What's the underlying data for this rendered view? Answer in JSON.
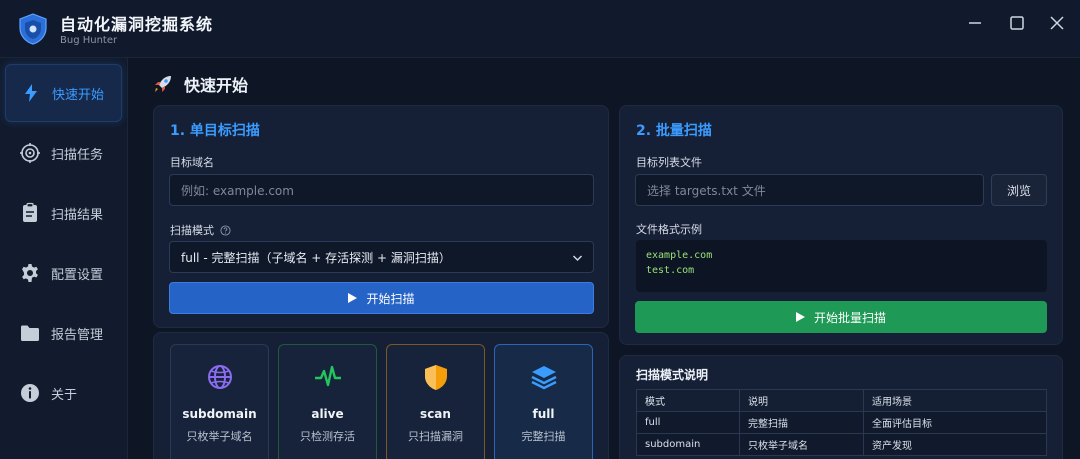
{
  "app": {
    "title": "自动化漏洞挖掘系统",
    "subtitle": "Bug Hunter",
    "logo_icon": "shield-icon",
    "accent_color": "#3b9cff"
  },
  "window_controls": {
    "minimize_icon": "minimize-icon",
    "maximize_icon": "maximize-icon",
    "close_icon": "close-icon"
  },
  "sidebar": {
    "items": [
      {
        "label": "快速开始",
        "icon": "lightning-icon",
        "active": true
      },
      {
        "label": "扫描任务",
        "icon": "target-icon",
        "active": false
      },
      {
        "label": "扫描结果",
        "icon": "clipboard-icon",
        "active": false
      },
      {
        "label": "配置设置",
        "icon": "gear-icon",
        "active": false
      },
      {
        "label": "报告管理",
        "icon": "folder-icon",
        "active": false
      },
      {
        "label": "关于",
        "icon": "info-icon",
        "active": false
      }
    ]
  },
  "main": {
    "page_title": "快速开始",
    "page_title_icon": "rocket-icon",
    "single_scan": {
      "title": "1. 单目标扫描",
      "domain_label": "目标域名",
      "domain_placeholder": "例如: example.com",
      "mode_label": "扫描模式",
      "mode_value": "full - 完整扫描（子域名 + 存活探测 + 漏洞扫描）",
      "start_button": "开始扫描"
    },
    "batch_scan": {
      "title": "2. 批量扫描",
      "file_label": "目标列表文件",
      "file_placeholder": "选择 targets.txt 文件",
      "browse_button": "浏览",
      "example_label": "文件格式示例",
      "example_lines": [
        "example.com",
        "test.com"
      ],
      "start_button": "开始批量扫描",
      "button_color": "#1f9a56"
    },
    "mode_cards": [
      {
        "name": "subdomain",
        "desc": "只枚举子域名",
        "icon": "globe-icon",
        "color": "#8b6cf0"
      },
      {
        "name": "alive",
        "desc": "只检测存活",
        "icon": "pulse-icon",
        "color": "#22c55e"
      },
      {
        "name": "scan",
        "desc": "只扫描漏洞",
        "icon": "shield-icon",
        "color": "#f59e0b"
      },
      {
        "name": "full",
        "desc": "完整扫描",
        "icon": "layers-icon",
        "color": "#3b9cff"
      }
    ],
    "mode_table": {
      "title": "扫描模式说明",
      "headers": [
        "模式",
        "说明",
        "适用场景"
      ],
      "rows": [
        [
          "full",
          "完整扫描",
          "全面评估目标"
        ],
        [
          "subdomain",
          "只枚举子域名",
          "资产发现"
        ]
      ]
    }
  }
}
